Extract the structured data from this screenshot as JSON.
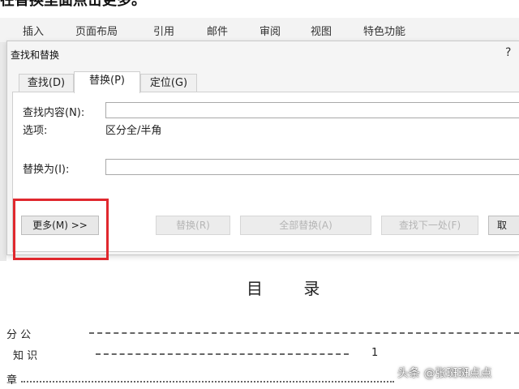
{
  "top_caption": "在替换里面点击更多。",
  "ribbon": {
    "tabs": [
      "插入",
      "页面布局",
      "引用",
      "邮件",
      "审阅",
      "视图",
      "特色功能"
    ]
  },
  "dialog": {
    "title": "查找和替换",
    "help": "?",
    "tabs": [
      {
        "label": "查找(D)",
        "active": false
      },
      {
        "label": "替换(P)",
        "active": true
      },
      {
        "label": "定位(G)",
        "active": false
      }
    ],
    "find_label": "查找内容(N):",
    "find_value": "",
    "options_label": "选项:",
    "options_value": "区分全/半角",
    "replace_label": "替换为(I):",
    "replace_value": "",
    "buttons": {
      "more": "更多(M) >>",
      "replace": "替换(R)",
      "replace_all": "全部替换(A)",
      "find_next": "查找下一处(F)",
      "cancel": "取"
    }
  },
  "document": {
    "toc_title": "目 录",
    "lines": [
      {
        "label": "分 公",
        "page": ""
      },
      {
        "label": "知 识",
        "page": "1"
      },
      {
        "label": "章",
        "page": ""
      }
    ]
  },
  "watermark": "头条 @张斑斑点点",
  "colors": {
    "highlight": "#e0282e"
  }
}
